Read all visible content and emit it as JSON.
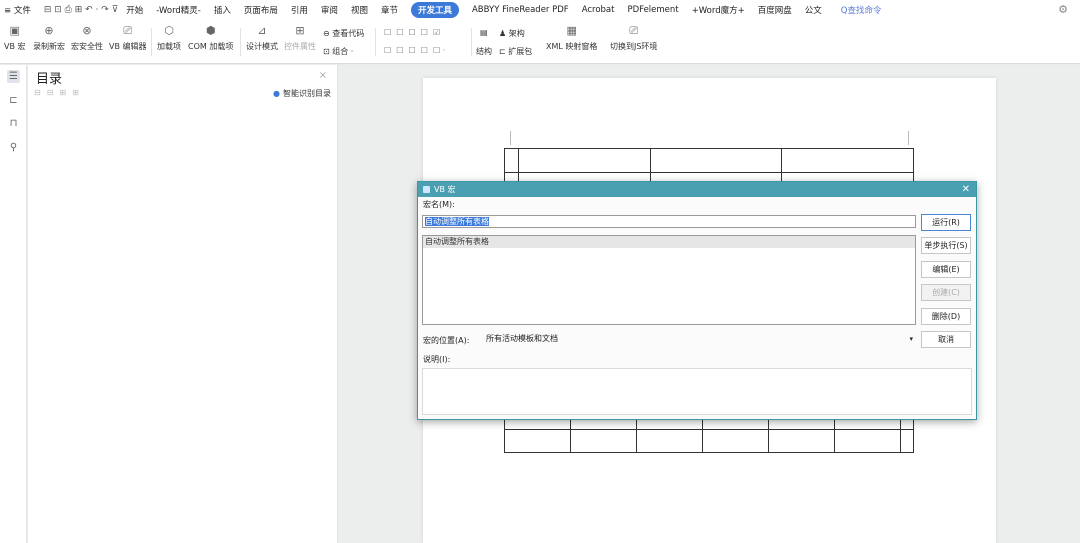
{
  "menubar": {
    "items": [
      "≡ 文件",
      "开始",
      "-Word精灵-",
      "插入",
      "页面布局",
      "引用",
      "审阅",
      "视图",
      "章节",
      "开发工具",
      "ABBYY FineReader PDF",
      "Acrobat",
      "PDFelement",
      "+Word魔方+",
      "百度网盘",
      "公文"
    ],
    "active": "开发工具",
    "search": "Q查找命令"
  },
  "ribbon": {
    "vb_macro": "VB 宏",
    "record_macro": "录制新宏",
    "macro_security": "宏安全性",
    "vb_editor": "VB 编辑器",
    "addins": "加载项",
    "com_addins": "COM 加载项",
    "design_mode": "设计模式",
    "control_props": "控件属性",
    "view_code": "查看代码",
    "group": "组合 ·",
    "structure": "结构",
    "schema": "架构",
    "expansion": "扩展包",
    "xml_mapping": "XML 映射窗格",
    "switch_js": "切换到JS环境"
  },
  "toc": {
    "title": "目录",
    "smart": "智能识别目录"
  },
  "dialog": {
    "title": "VB 宏",
    "macro_name_label": "宏名(M):",
    "macro_name_value": "自动调整所有表格",
    "macro_list": [
      "自动调整所有表格"
    ],
    "buttons": {
      "run": "运行(R)",
      "step": "单步执行(S)",
      "edit": "编辑(E)",
      "create": "创建(C)",
      "delete": "删除(D)",
      "cancel": "取消"
    },
    "location_label": "宏的位置(A):",
    "location_value": "所有活动模板和文档",
    "description_label": "说明(I):"
  }
}
